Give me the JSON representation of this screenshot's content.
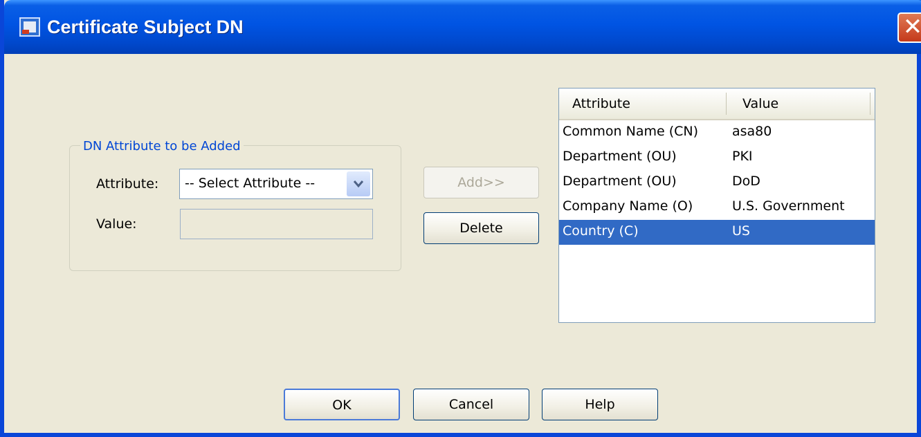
{
  "window": {
    "title": "Certificate Subject DN",
    "close_glyph": "✕"
  },
  "group": {
    "title": "DN Attribute to be Added",
    "attribute_label": "Attribute:",
    "attribute_selected": "-- Select Attribute --",
    "value_label": "Value:",
    "value_text": ""
  },
  "buttons": {
    "add": "Add>>",
    "delete": "Delete",
    "ok": "OK",
    "cancel": "Cancel",
    "help": "Help"
  },
  "table": {
    "columns": [
      "Attribute",
      "Value"
    ],
    "rows": [
      {
        "attribute": "Common Name (CN)",
        "value": "asa80"
      },
      {
        "attribute": "Department (OU)",
        "value": "PKI"
      },
      {
        "attribute": "Department (OU)",
        "value": "DoD"
      },
      {
        "attribute": "Company Name (O)",
        "value": "U.S. Government"
      },
      {
        "attribute": "Country (C)",
        "value": "US"
      }
    ],
    "selected_index": 4
  },
  "colors": {
    "title_bar": "#0054e3",
    "selection": "#316ac5",
    "group_title": "#0046d5",
    "dialog_bg": "#ece9d8"
  }
}
